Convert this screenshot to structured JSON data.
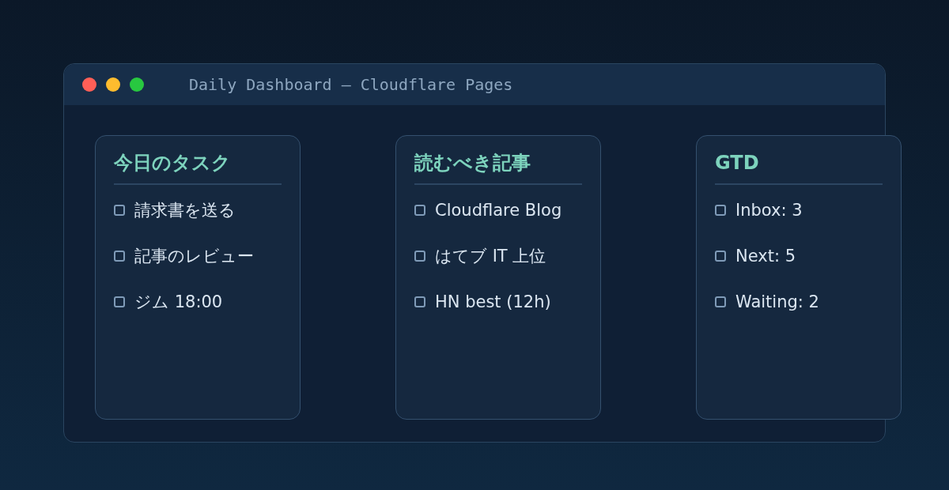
{
  "window": {
    "title": "Daily Dashboard — Cloudflare Pages"
  },
  "cards": [
    {
      "title": "今日のタスク",
      "items": [
        {
          "label": "請求書を送る",
          "checked": false
        },
        {
          "label": "記事のレビュー",
          "checked": false
        },
        {
          "label": "ジム 18:00",
          "checked": false
        }
      ]
    },
    {
      "title": "読むべき記事",
      "items": [
        {
          "label": "Cloudflare Blog",
          "checked": false
        },
        {
          "label": "はてブ IT 上位",
          "checked": false
        },
        {
          "label": "HN best (12h)",
          "checked": false
        }
      ]
    },
    {
      "title": "GTD",
      "items": [
        {
          "label": "Inbox: 3",
          "checked": false
        },
        {
          "label": "Next: 5",
          "checked": false
        },
        {
          "label": "Waiting: 2",
          "checked": false
        }
      ]
    }
  ]
}
